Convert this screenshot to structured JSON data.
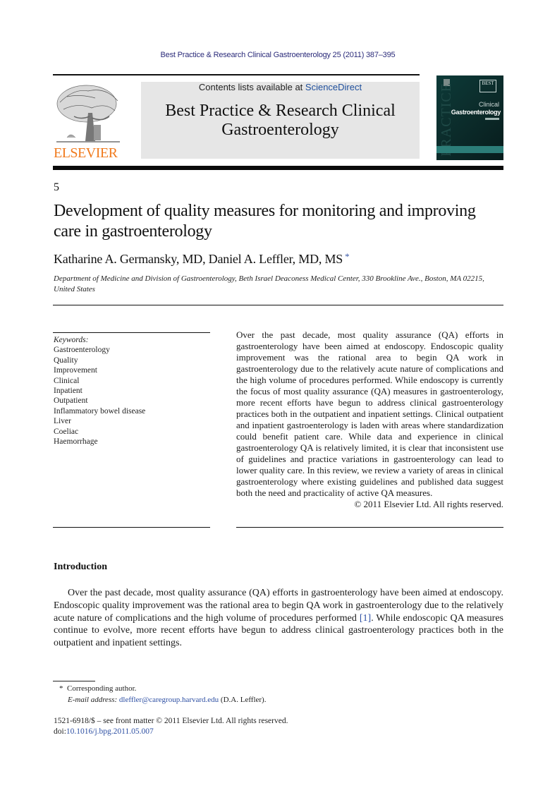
{
  "header": {
    "journal_ref": "Best Practice & Research Clinical Gastroenterology 25 (2011) 387–395",
    "contents_prefix": "Contents lists available at ",
    "contents_link": "ScienceDirect",
    "journal_title_line1": "Best Practice & Research Clinical",
    "journal_title_line2": "Gastroenterology",
    "publisher_logo_text": "ELSEVIER",
    "cover": {
      "badge": "BEST",
      "vertical_text": "PRACTICE",
      "line1": "Clinical",
      "line2": "Gastroenterology"
    },
    "colors": {
      "publisher_orange": "#f07a1d",
      "link_blue": "#2d4fa3",
      "cover_teal": "#2c7d78"
    }
  },
  "article": {
    "number": "5",
    "title": "Development of quality measures for monitoring and improving care in gastroenterology",
    "authors": "Katharine A. Germansky, MD, Daniel A. Leffler, MD, MS",
    "author_mark": "*",
    "affiliation": "Department of Medicine and Division of Gastroenterology, Beth Israel Deaconess Medical Center, 330 Brookline Ave., Boston, MA 02215, United States"
  },
  "keywords": {
    "heading": "Keywords:",
    "items": [
      "Gastroenterology",
      "Quality",
      "Improvement",
      "Clinical",
      "Inpatient",
      "Outpatient",
      "Inflammatory bowel disease",
      "Liver",
      "Coeliac",
      "Haemorrhage"
    ]
  },
  "abstract": {
    "text": "Over the past decade, most quality assurance (QA) efforts in gastroenterology have been aimed at endoscopy. Endoscopic quality improvement was the rational area to begin QA work in gastroenterology due to the relatively acute nature of complications and the high volume of procedures performed. While endoscopy is currently the focus of most quality assurance (QA) measures in gastroenterology, more recent efforts have begun to address clinical gastroenterology practices both in the outpatient and inpatient settings. Clinical outpatient and inpatient gastroenterology is laden with areas where standardization could benefit patient care. While data and experience in clinical gastroenterology QA is relatively limited, it is clear that inconsistent use of guidelines and practice variations in gastroenterology can lead to lower quality care. In this review, we review a variety of areas in clinical gastroenterology where existing guidelines and published data suggest both the need and practicality of active QA measures.",
    "copyright": "© 2011 Elsevier Ltd. All rights reserved."
  },
  "introduction": {
    "heading": "Introduction",
    "text_before_ref": "Over the past decade, most quality assurance (QA) efforts in gastroenterology have been aimed at endoscopy. Endoscopic quality improvement was the rational area to begin QA work in gastroenterology due to the relatively acute nature of complications and the high volume of procedures performed ",
    "ref": "[1]",
    "text_after_ref": ". While endoscopic QA measures continue to evolve, more recent efforts have begun to address clinical gastroenterology practices both in the outpatient and inpatient settings."
  },
  "footnote": {
    "mark": "*",
    "corresponding": "Corresponding author.",
    "email_label": "E-mail address:",
    "email": "dleffler@caregroup.harvard.edu",
    "email_suffix": "(D.A. Leffler)."
  },
  "footer": {
    "issn_line": "1521-6918/$ – see front matter © 2011 Elsevier Ltd. All rights reserved.",
    "doi_prefix": "doi:",
    "doi": "10.1016/j.bpg.2011.05.007"
  }
}
